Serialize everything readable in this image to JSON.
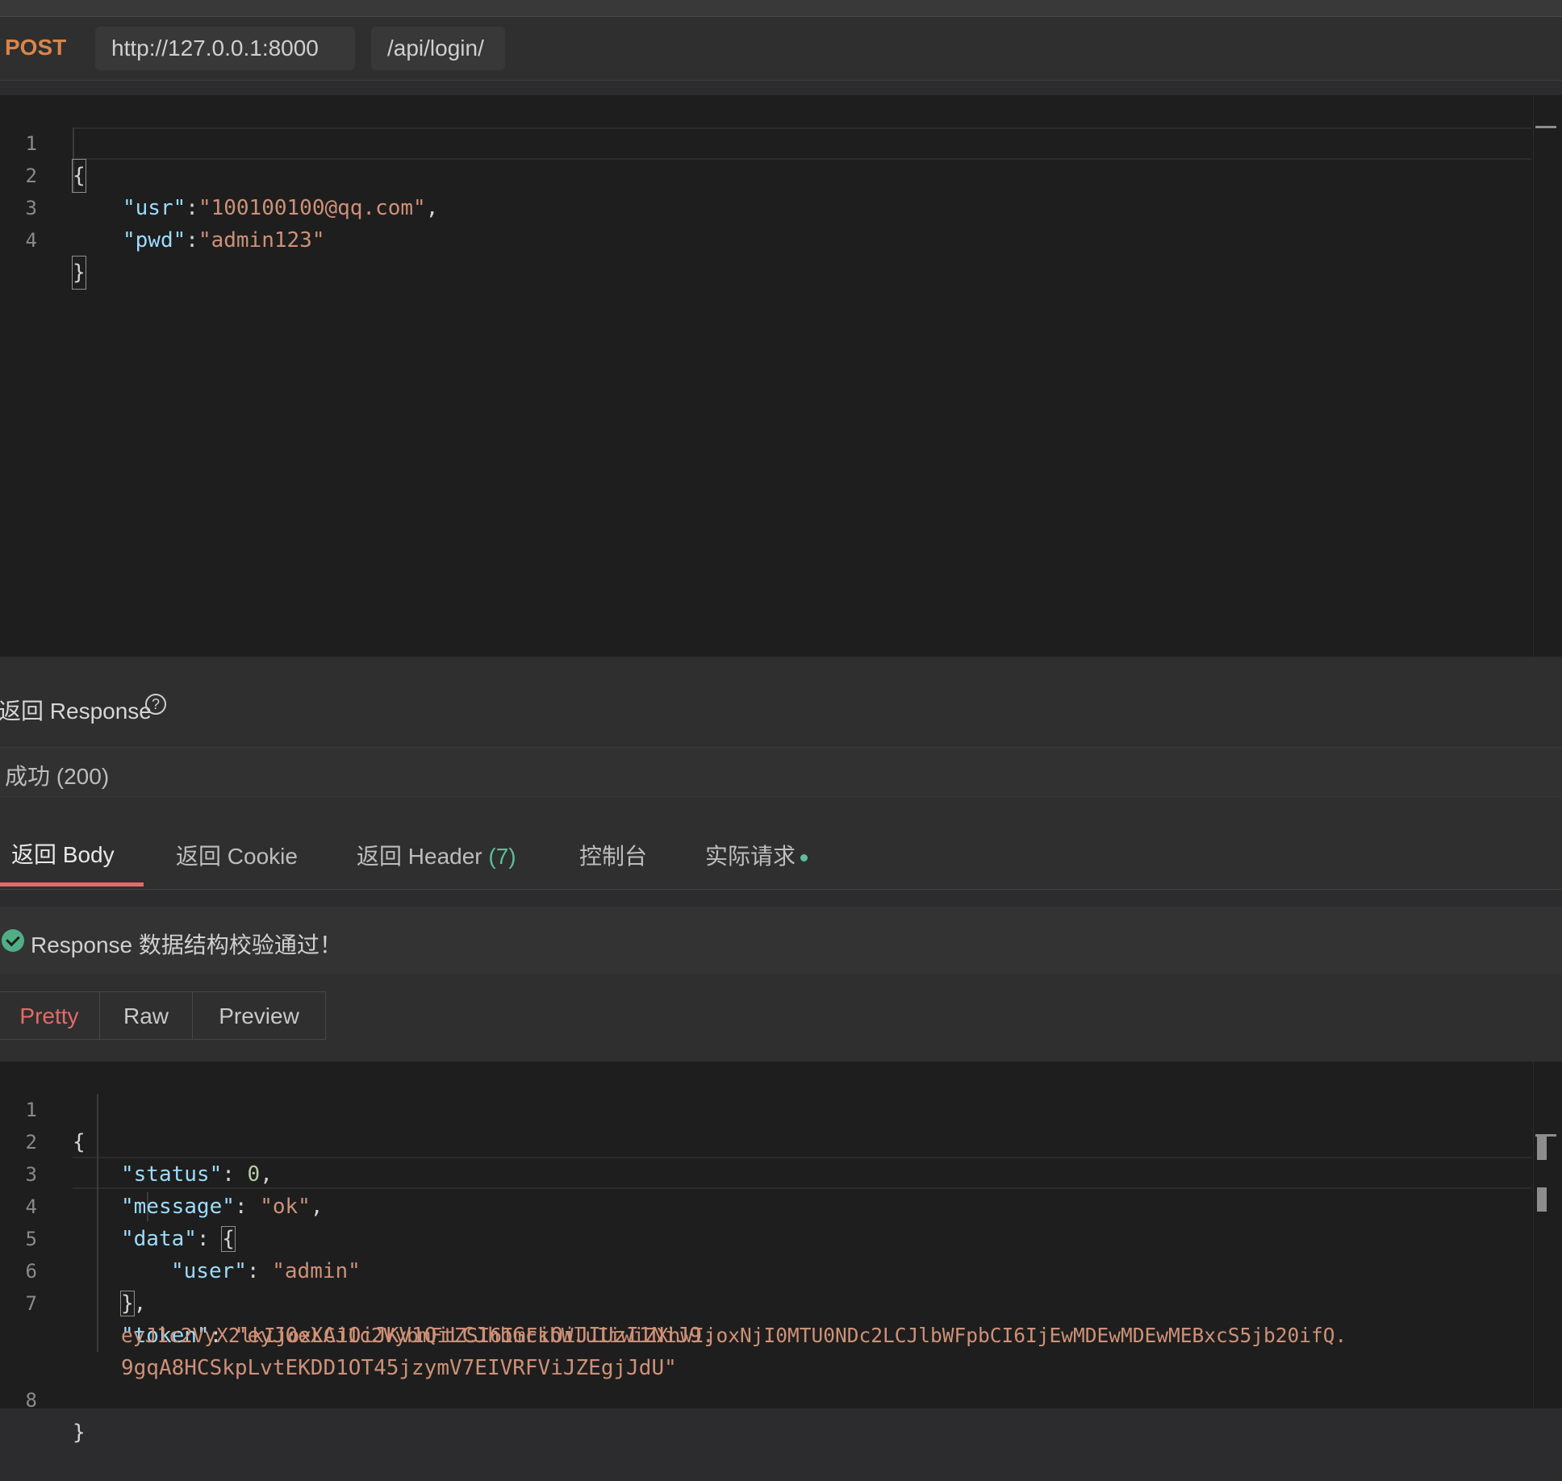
{
  "request": {
    "method": "POST",
    "base_url": "http://127.0.0.1:8000",
    "path": "/api/login/"
  },
  "request_body": {
    "line_numbers": [
      "1",
      "2",
      "3",
      "4"
    ],
    "open_brace": "{",
    "usr_key": "\"usr\"",
    "usr_value": "\"100100100@qq.com\"",
    "pwd_key": "\"pwd\"",
    "pwd_value": "\"admin123\"",
    "close_brace": "}"
  },
  "response": {
    "title": "返回 Response",
    "help_icon": "question-circle-icon",
    "status": "成功 (200)",
    "tabs": {
      "body": "返回 Body",
      "cookie": "返回 Cookie",
      "header": "返回 Header",
      "header_count": "(7)",
      "console": "控制台",
      "actual_request": "实际请求"
    },
    "validation_message": "Response 数据结构校验通过！",
    "view_modes": {
      "pretty": "Pretty",
      "raw": "Raw",
      "preview": "Preview"
    },
    "accent_color": "#e46a6a",
    "success_color": "#4fae86"
  },
  "response_body": {
    "line_numbers": [
      "1",
      "2",
      "3",
      "4",
      "5",
      "6",
      "7",
      "8"
    ],
    "status_key": "\"status\"",
    "status_value": "0",
    "message_key": "\"message\"",
    "message_value": "\"ok\"",
    "data_key": "\"data\"",
    "user_key": "\"user\"",
    "user_value": "\"admin\"",
    "token_key": "\"token\"",
    "token_value_1": "\"eyJ0eXAiOiJKV1QiLCJhbGciOiJIUzI1NiJ9.",
    "token_value_2": "eyJ1c2VyX2lkIjoxLCJ1c2VybmFtZSI6ImFkbWluIiwiZXhwIjoxNjI0MTU0NDc2LCJlbWFpbCI6IjEwMDEwMDEwMEBxcS5jb20ifQ.",
    "token_value_3": "9gqA8HCSkpLvtEKDD1OT45jzymV7EIVRFViJZEgjJdU\""
  }
}
